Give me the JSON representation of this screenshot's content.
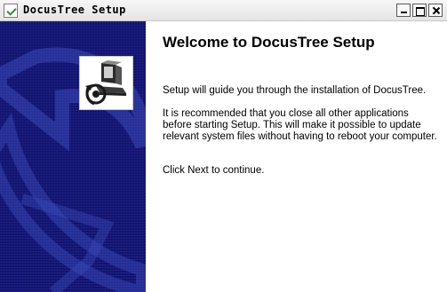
{
  "window": {
    "title": "DocusTree Setup",
    "icon": "setup-check-icon",
    "controls": [
      "minimize",
      "maximize",
      "close"
    ]
  },
  "banner": {
    "background_color": "#0a0d6e",
    "logo_icon": "installer-computer-icon"
  },
  "content": {
    "heading": "Welcome to DocusTree Setup",
    "intro": "Setup will guide you through the installation of DocusTree.",
    "recommendation": "It is recommended that you close all other applications before starting Setup. This will make it possible to update relevant system files without having to reboot your computer.",
    "continue_hint": "Click Next to continue."
  }
}
